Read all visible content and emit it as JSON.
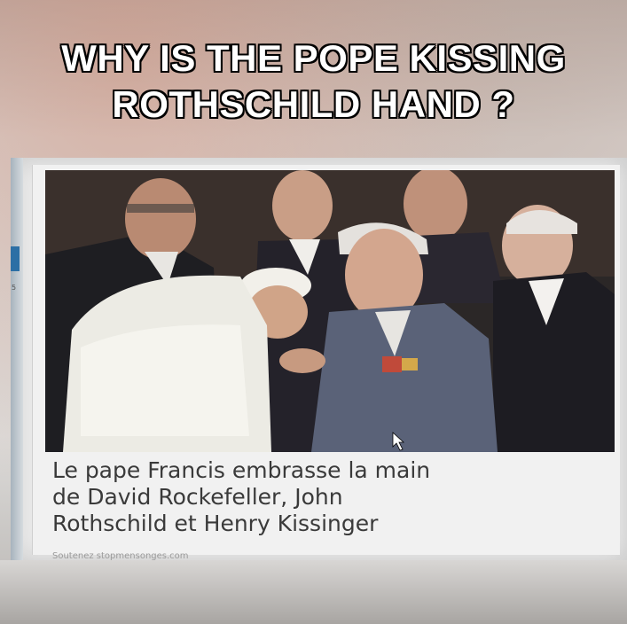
{
  "headline": {
    "line1": "WHY IS THE POPE KISSING",
    "line2": "ROTHSCHILD HAND ?"
  },
  "article": {
    "caption_line1": "Le pape Francis embrasse la main",
    "caption_line2": "de David Rockefeller, John",
    "caption_line3": "Rothschild et Henry Kissinger",
    "source": "Soutenez stopmensonges.com"
  },
  "sidebar": {
    "number": "5"
  }
}
